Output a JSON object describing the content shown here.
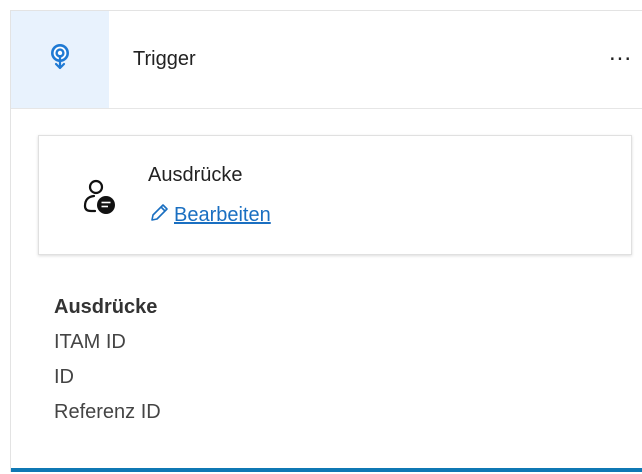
{
  "header": {
    "icon": "trigger-icon",
    "title": "Trigger",
    "more_label": "..."
  },
  "expression_card": {
    "icon": "user-expression-icon",
    "title": "Ausdrücke",
    "edit_icon": "pencil-icon",
    "edit_label": "Bearbeiten"
  },
  "expressions": {
    "heading": "Ausdrücke",
    "items": [
      "ITAM ID",
      "ID",
      "Referenz ID"
    ]
  },
  "colors": {
    "accent": "#1a6fc1",
    "icon_tile_bg": "#e8f2fd",
    "bottom_bar": "#0f78b4"
  }
}
